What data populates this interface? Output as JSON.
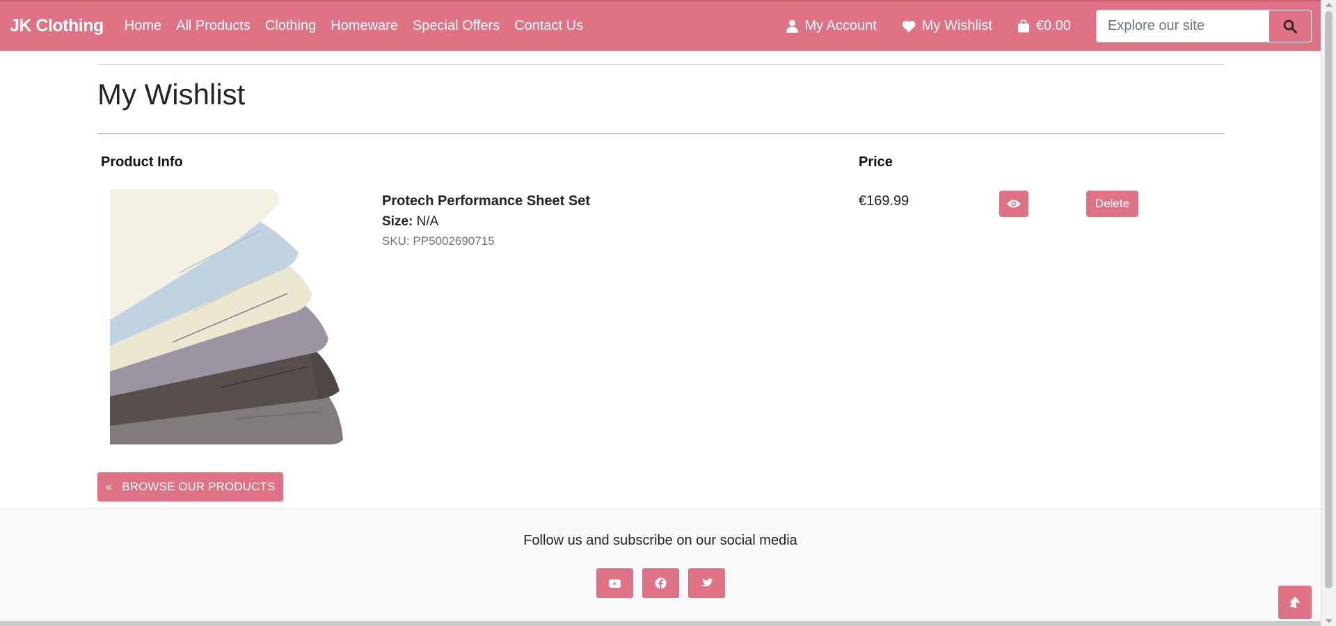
{
  "brand": "JK Clothing",
  "nav": {
    "links": [
      "Home",
      "All Products",
      "Clothing",
      "Homeware",
      "Special Offers",
      "Contact Us"
    ],
    "account_label": "My Account",
    "wishlist_label": "My Wishlist",
    "cart_total": "€0.00",
    "search_placeholder": "Explore our site"
  },
  "page": {
    "title": "My Wishlist",
    "columns": {
      "info": "Product Info",
      "price": "Price"
    }
  },
  "wishlist": {
    "items": [
      {
        "name": "Protech Performance Sheet Set",
        "size_label": "Size:",
        "size_value": "N/A",
        "sku": "SKU: PP5002690715",
        "price": "€169.99",
        "delete_label": "Delete"
      }
    ]
  },
  "browse_label": "BROWSE OUR PRODUCTS",
  "footer": {
    "text": "Follow us and subscribe on our social media",
    "socials": [
      "youtube-icon",
      "facebook-icon",
      "twitter-icon"
    ]
  },
  "colors": {
    "accent": "#df7284",
    "footer_bg": "#f8f9fa"
  }
}
